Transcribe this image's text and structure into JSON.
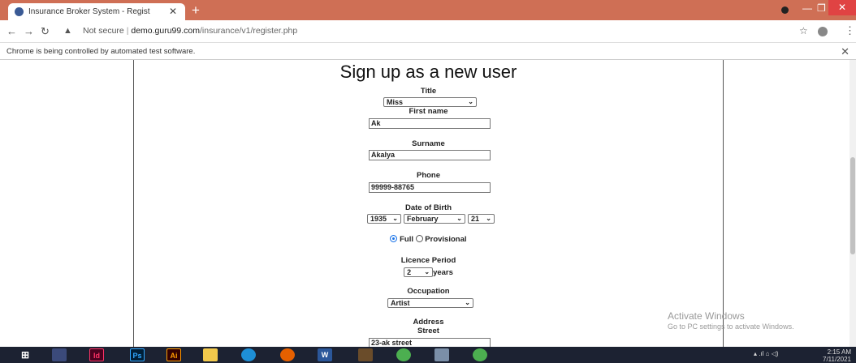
{
  "browser": {
    "tab_title": "Insurance Broker System - Regist",
    "tab_close": "✕",
    "new_tab": "+",
    "url_security": "Not secure",
    "url_host": "demo.guru99.com",
    "url_path": "/insurance/v1/register.php",
    "automation_notice": "Chrome is being controlled by automated test software."
  },
  "form": {
    "heading": "Sign up as a new user",
    "title_label": "Title",
    "title_value": "Miss",
    "first_name_label": "First name",
    "first_name_value": "Ak",
    "surname_label": "Surname",
    "surname_value": "Akalya",
    "phone_label": "Phone",
    "phone_value": "99999-88765",
    "dob_label": "Date of Birth",
    "dob_year": "1935",
    "dob_month": "February",
    "dob_day": "21",
    "licence_full": "Full",
    "licence_provisional": "Provisional",
    "licence_period_label": "Licence Period",
    "licence_period_value": "2",
    "licence_period_unit": "years",
    "occupation_label": "Occupation",
    "occupation_value": "Artist",
    "address_label": "Address",
    "street_label": "Street",
    "street_value": "23-ak street"
  },
  "watermark": {
    "line1": "Activate Windows",
    "line2": "Go to PC settings to activate Windows."
  },
  "taskbar": {
    "apps": [
      "Id",
      "Ps",
      "Ai",
      "W"
    ],
    "time": "2:15 AM",
    "date": "7/11/2021"
  },
  "colors": {
    "tabbar": "#cf6f55",
    "taskbar": "#1c2232",
    "radio_selected": "#1a73e8"
  }
}
